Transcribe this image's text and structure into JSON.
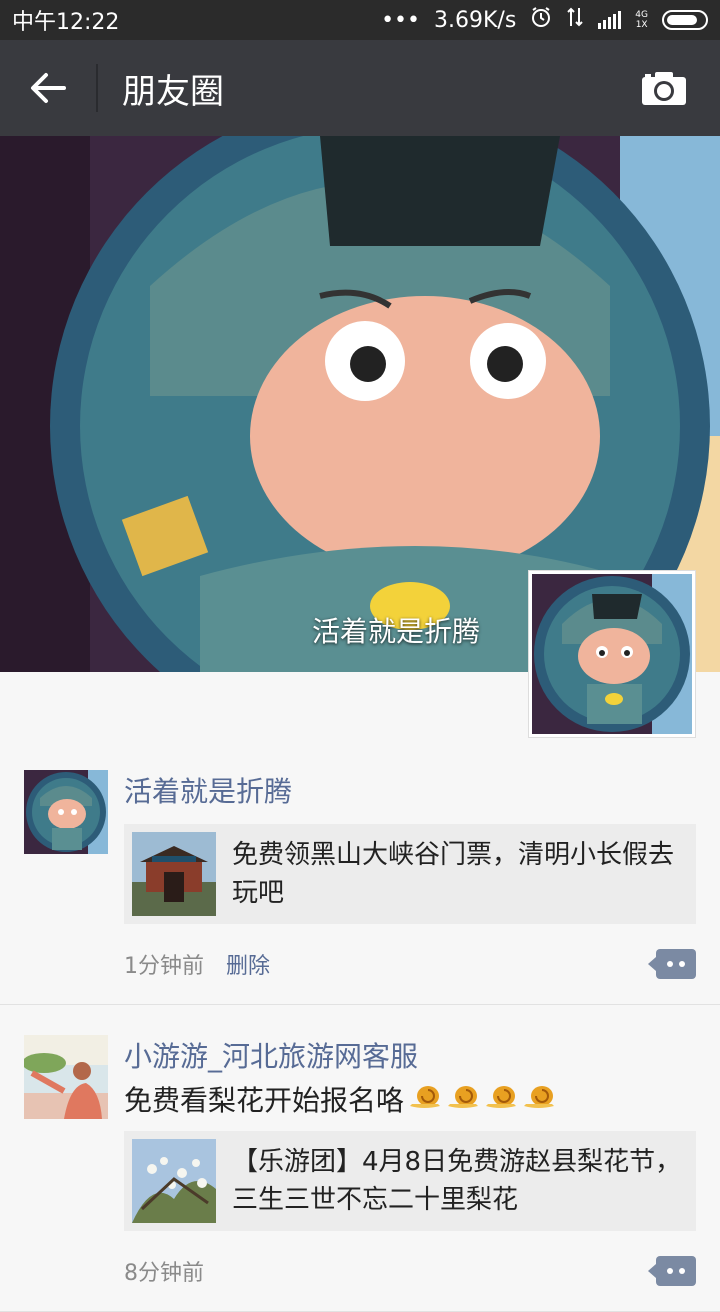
{
  "status_bar": {
    "time": "中午12:22",
    "dots": "•••",
    "speed": "3.69K/s",
    "network_top": "4G",
    "network_bottom": "1X"
  },
  "nav": {
    "title": "朋友圈",
    "back_icon": "arrow-left-icon",
    "camera_icon": "camera-icon"
  },
  "cover": {
    "user_name": "活着就是折腾"
  },
  "posts": [
    {
      "author": "活着就是折腾",
      "link_text": "免费领黑山大峡谷门票，清明小长假去玩吧",
      "time": "1分钟前",
      "delete_label": "删除"
    },
    {
      "author": "小游游_河北旅游网客服",
      "text": "免费看梨花开始报名咯",
      "link_text": "【乐游团】4月8日免费游赵县梨花节，三生三世不忘二十里梨花",
      "time": "8分钟前"
    }
  ],
  "colors": {
    "nav_bg": "#393a3f",
    "status_bg": "#2b2b2b",
    "link_blue": "#576b95",
    "card_bg": "#ececec"
  }
}
